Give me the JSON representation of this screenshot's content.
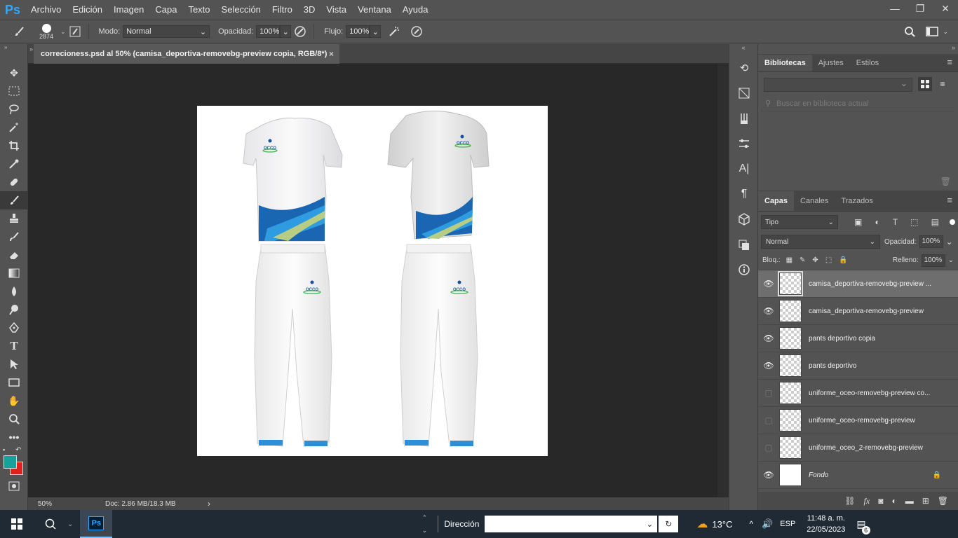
{
  "app": {
    "logo": "Ps",
    "accent": "#31a8ff"
  },
  "menu": [
    "Archivo",
    "Edición",
    "Imagen",
    "Capa",
    "Texto",
    "Selección",
    "Filtro",
    "3D",
    "Vista",
    "Ventana",
    "Ayuda"
  ],
  "window_controls": {
    "minimize": "—",
    "restore": "❐",
    "close": "✕"
  },
  "options": {
    "brush_size": "2874",
    "mode_label": "Modo:",
    "mode_value": "Normal",
    "opacity_label": "Opacidad:",
    "opacity_value": "100%",
    "flow_label": "Flujo:",
    "flow_value": "100%"
  },
  "document": {
    "tab_title": "correcioness.psd al 50% (camisa_deportiva-removebg-preview copia, RGB/8*)",
    "tab_close": "×",
    "logo_text": "OCCO"
  },
  "status": {
    "zoom": "50%",
    "doc_info": "Doc: 2.86 MB/18.3 MB",
    "arrow": "›"
  },
  "libraries": {
    "tabs": [
      "Bibliotecas",
      "Ajustes",
      "Estilos"
    ],
    "search_placeholder": "Buscar en biblioteca actual"
  },
  "layers_panel": {
    "tabs": [
      "Capas",
      "Canales",
      "Trazados"
    ],
    "filter_label": "Tipo",
    "blend_mode": "Normal",
    "opacity_label": "Opacidad:",
    "opacity_value": "100%",
    "lock_label": "Bloq.:",
    "fill_label": "Relleno:",
    "fill_value": "100%",
    "layers": [
      {
        "name": "camisa_deportiva-removebg-preview ...",
        "visible": true,
        "selected": true
      },
      {
        "name": "camisa_deportiva-removebg-preview",
        "visible": true,
        "selected": false
      },
      {
        "name": "pants deportivo copia",
        "visible": true,
        "selected": false
      },
      {
        "name": "pants deportivo",
        "visible": true,
        "selected": false
      },
      {
        "name": "uniforme_oceo-removebg-preview co...",
        "visible": false,
        "selected": false
      },
      {
        "name": "uniforme_oceo-removebg-preview",
        "visible": false,
        "selected": false
      },
      {
        "name": "uniforme_oceo_2-removebg-preview",
        "visible": false,
        "selected": false
      },
      {
        "name": "Fondo",
        "visible": true,
        "selected": false
      }
    ]
  },
  "taskbar": {
    "address_label": "Dirección",
    "temperature": "13°C",
    "language": "ESP",
    "time": "11:48 a. m.",
    "date": "22/05/2023",
    "notifications": "6",
    "ps_label": "Ps"
  }
}
